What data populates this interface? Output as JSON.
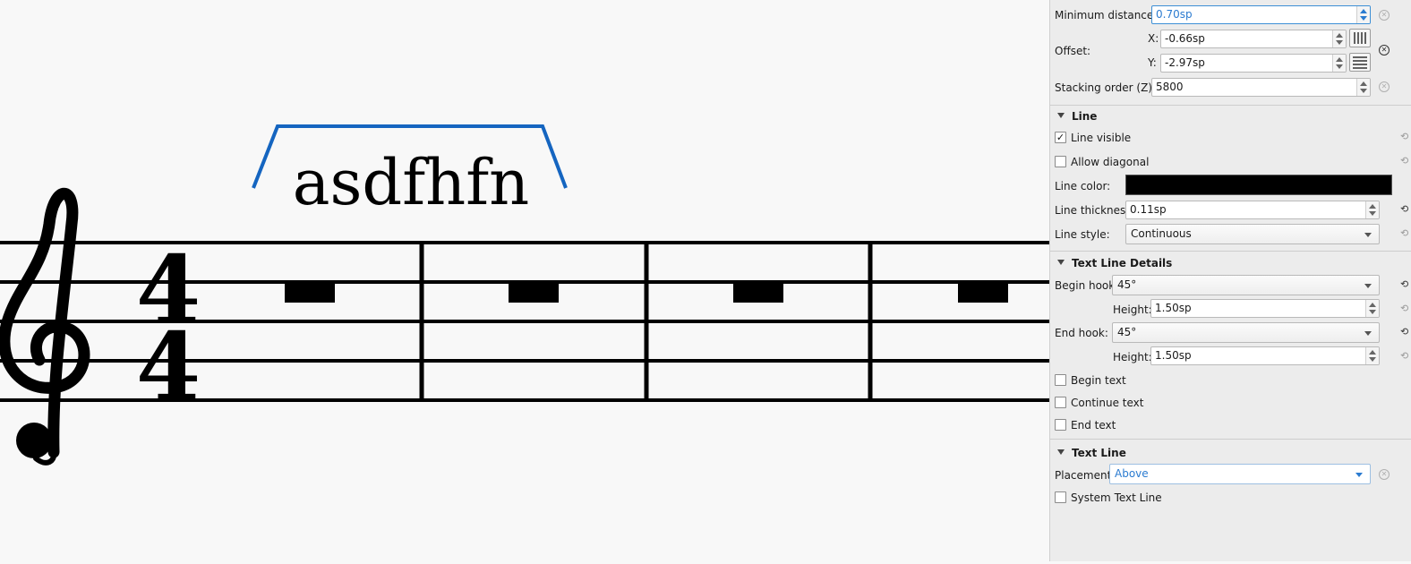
{
  "score": {
    "text_line": "asdfhfn",
    "time_signature_top": "4",
    "time_signature_bottom": "4",
    "accent_color": "#1565c0",
    "clef_icon": "treble-clef-icon",
    "rest_icon": "whole-rest-icon"
  },
  "panel": {
    "min_distance": {
      "label": "Minimum distance:",
      "value": "0.70sp"
    },
    "offset": {
      "label": "Offset:",
      "x_label": "X:",
      "x_value": "-0.66sp",
      "y_label": "Y:",
      "y_value": "-2.97sp",
      "x_icon": "snap-to-grid-vertical-icon",
      "y_icon": "snap-to-grid-horizontal-icon"
    },
    "stacking": {
      "label": "Stacking order (Z):",
      "value": "5800"
    },
    "line": {
      "header": "Line",
      "line_visible": {
        "label": "Line visible",
        "checked": true
      },
      "allow_diagonal": {
        "label": "Allow diagonal",
        "checked": false
      },
      "line_color": {
        "label": "Line color:",
        "value": "#000000"
      },
      "line_thickness": {
        "label": "Line thickness:",
        "value": "0.11sp"
      },
      "line_style": {
        "label": "Line style:",
        "value": "Continuous"
      }
    },
    "details": {
      "header": "Text Line Details",
      "begin_hook": {
        "label": "Begin hook:",
        "value": "45°",
        "height_label": "Height:",
        "height_value": "1.50sp"
      },
      "end_hook": {
        "label": "End hook:",
        "value": "45°",
        "height_label": "Height:",
        "height_value": "1.50sp"
      },
      "begin_text": "Begin text",
      "continue_text": "Continue text",
      "end_text": "End text"
    },
    "text_line": {
      "header": "Text Line",
      "placement": {
        "label": "Placement:",
        "value": "Above"
      },
      "system_text_line": "System Text Line"
    },
    "reset_icon": "reset-icon",
    "check_mark": "✓"
  }
}
